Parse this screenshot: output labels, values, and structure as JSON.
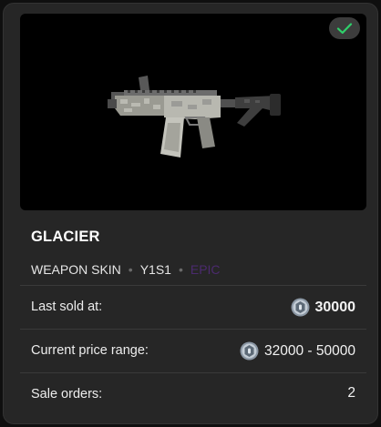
{
  "item": {
    "name": "GLACIER",
    "type": "WEAPON SKIN",
    "season": "Y1S1",
    "rarity": "EPIC",
    "owned": true,
    "image_icon": "rifle-icon"
  },
  "details": {
    "last_sold_label": "Last sold at:",
    "last_sold_value": "30000",
    "price_range_label": "Current price range:",
    "price_range_value": "32000 - 50000",
    "sale_orders_label": "Sale orders:",
    "sale_orders_value": "2",
    "currency_icon": "r6-credits-icon"
  },
  "colors": {
    "card_bg": "#262626",
    "accent_check": "#2fd06a",
    "rarity_epic": "#4b2a6e"
  }
}
